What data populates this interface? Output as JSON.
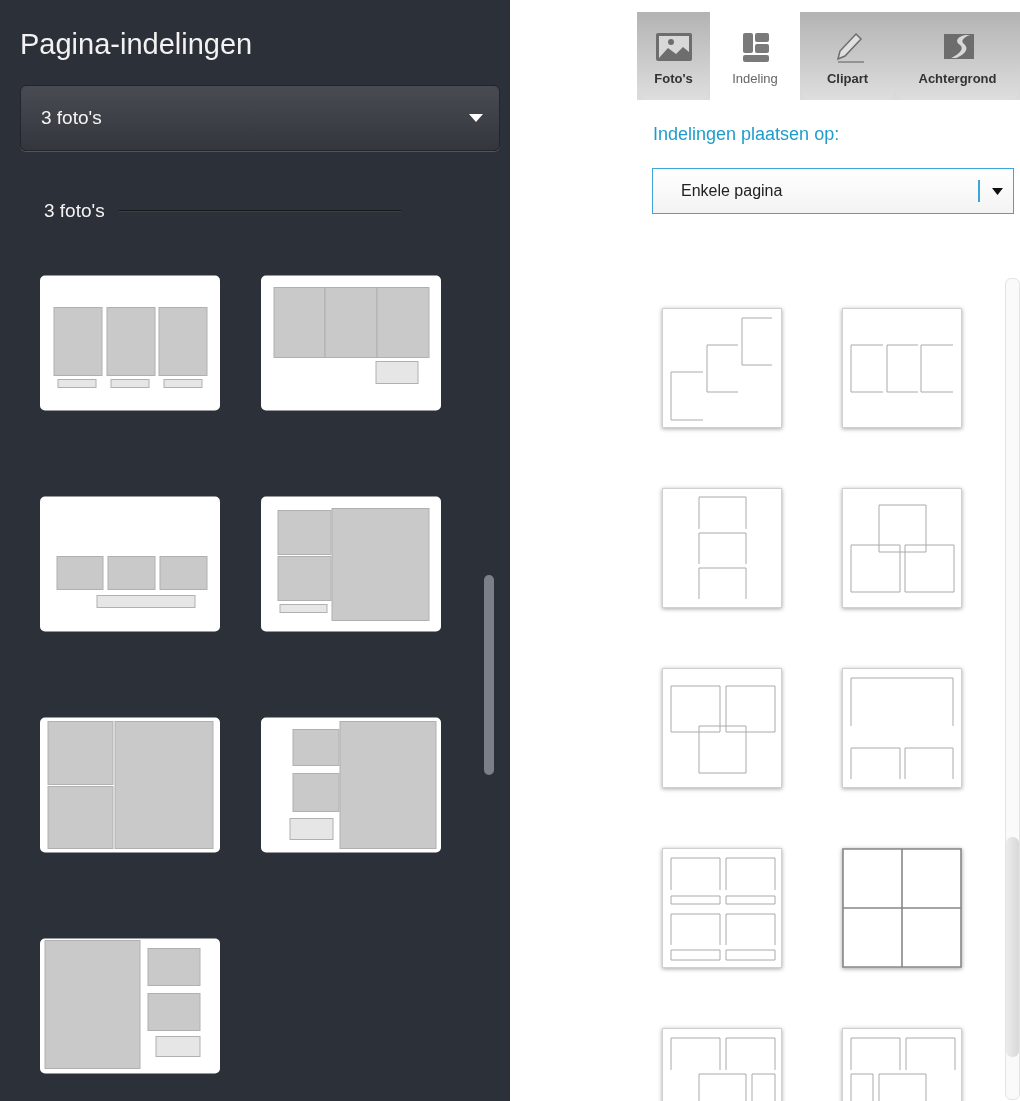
{
  "left_panel": {
    "title": "Pagina-indelingen",
    "dropdown": {
      "value": "3 foto's"
    },
    "section_heading": "3 foto's"
  },
  "right_panel": {
    "tabs": [
      {
        "label": "Foto's",
        "kind": "photo",
        "selected": false
      },
      {
        "label": "Indeling",
        "kind": "layout",
        "selected": true
      },
      {
        "label": "Clipart",
        "kind": "pencil",
        "selected": false
      },
      {
        "label": "Achtergrond",
        "kind": "background",
        "selected": false
      }
    ],
    "placement_label": "Indelingen plaatsen op:",
    "placement_dropdown": {
      "value": "Enkele pagina"
    }
  }
}
